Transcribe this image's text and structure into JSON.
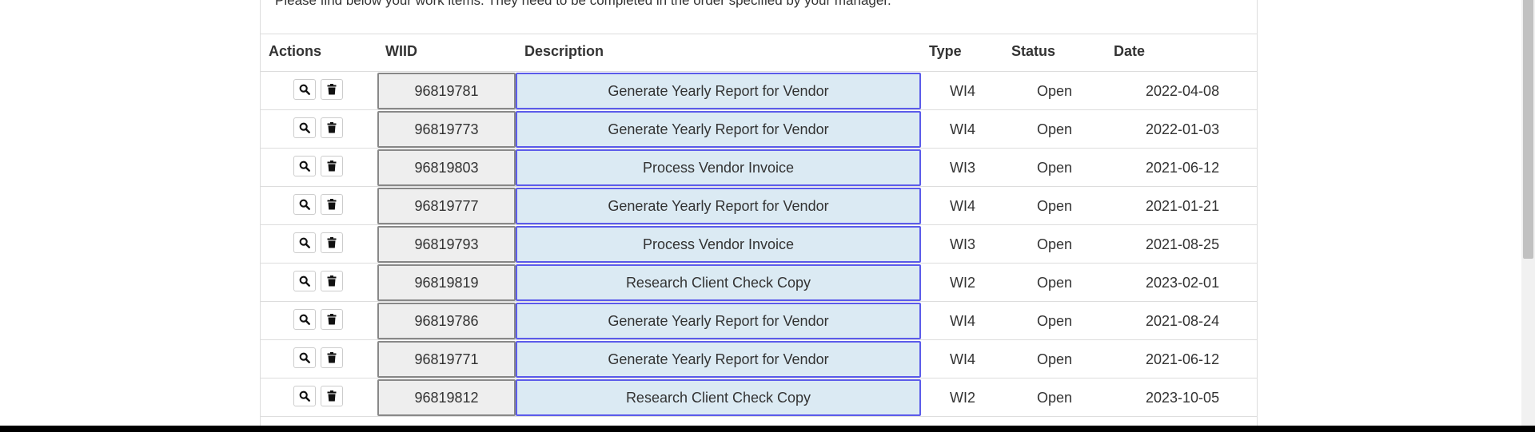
{
  "intro_text": "Please find below your work items. They need to be completed in the order specified by your manager.",
  "columns": {
    "actions": "Actions",
    "wiid": "WIID",
    "description": "Description",
    "type": "Type",
    "status": "Status",
    "date": "Date"
  },
  "rows": [
    {
      "wiid": "96819781",
      "description": "Generate Yearly Report for Vendor",
      "type": "WI4",
      "status": "Open",
      "date": "2022-04-08"
    },
    {
      "wiid": "96819773",
      "description": "Generate Yearly Report for Vendor",
      "type": "WI4",
      "status": "Open",
      "date": "2022-01-03"
    },
    {
      "wiid": "96819803",
      "description": "Process Vendor Invoice",
      "type": "WI3",
      "status": "Open",
      "date": "2021-06-12"
    },
    {
      "wiid": "96819777",
      "description": "Generate Yearly Report for Vendor",
      "type": "WI4",
      "status": "Open",
      "date": "2021-01-21"
    },
    {
      "wiid": "96819793",
      "description": "Process Vendor Invoice",
      "type": "WI3",
      "status": "Open",
      "date": "2021-08-25"
    },
    {
      "wiid": "96819819",
      "description": "Research Client Check Copy",
      "type": "WI2",
      "status": "Open",
      "date": "2023-02-01"
    },
    {
      "wiid": "96819786",
      "description": "Generate Yearly Report for Vendor",
      "type": "WI4",
      "status": "Open",
      "date": "2021-08-24"
    },
    {
      "wiid": "96819771",
      "description": "Generate Yearly Report for Vendor",
      "type": "WI4",
      "status": "Open",
      "date": "2021-06-12"
    },
    {
      "wiid": "96819812",
      "description": "Research Client Check Copy",
      "type": "WI2",
      "status": "Open",
      "date": "2023-10-05"
    }
  ],
  "icons": {
    "view": "search-icon",
    "delete": "trash-icon"
  },
  "colors": {
    "wiid_bg": "#eeeeee",
    "wiid_border": "#888888",
    "desc_bg": "#dbeaf3",
    "desc_border": "#5b5bea"
  }
}
